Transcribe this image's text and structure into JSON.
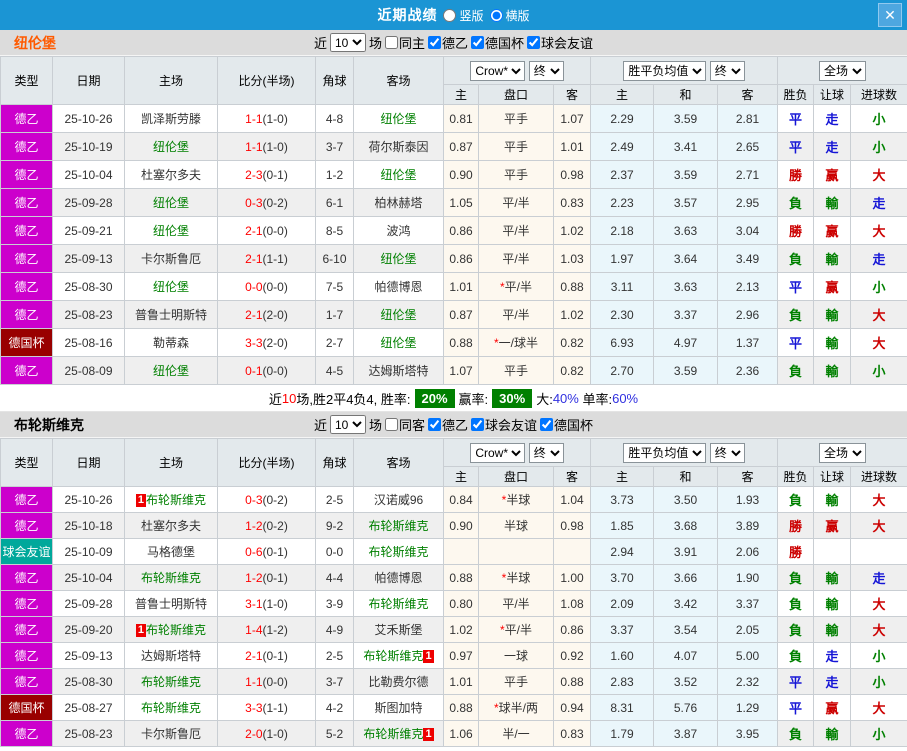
{
  "titlebar": {
    "title": "近期战绩",
    "radio_vertical_label": "竖版",
    "radio_vertical_checked": false,
    "radio_horizontal_label": "横版",
    "radio_horizontal_checked": true,
    "close_glyph": "✕"
  },
  "marks": {
    "star": "*",
    "red_card": "1"
  },
  "table_header": {
    "main_cols": [
      "类型",
      "日期",
      "主场",
      "比分(半场)",
      "角球",
      "客场"
    ],
    "sub_cols": [
      "主",
      "盘口",
      "客",
      "主",
      "和",
      "客",
      "胜负",
      "让球",
      "进球数"
    ],
    "company_select": "Crow*",
    "final_select_1": "终",
    "europe_select": "胜平负均值",
    "final_select_2": "终",
    "scope_select": "全场"
  },
  "sections": [
    {
      "team": "纽伦堡",
      "filter": {
        "near_label": "近",
        "count": "10",
        "games_label": "场",
        "same_label": "同主",
        "same_checked": false,
        "leagues": [
          {
            "label": "德乙",
            "checked": true
          },
          {
            "label": "德国杯",
            "checked": true
          },
          {
            "label": "球会友谊",
            "checked": true
          }
        ]
      },
      "rows": [
        {
          "type": "德乙",
          "type_class": "league",
          "date": "25-10-26",
          "home": "凯泽斯劳滕",
          "home_green": false,
          "home_badge": null,
          "score": "1-1",
          "half": "(1-0)",
          "corner": "4-8",
          "away": "纽伦堡",
          "away_green": true,
          "away_badge": null,
          "asia_home": "0.81",
          "handicap": "平手",
          "handicap_star": false,
          "asia_away": "1.07",
          "eu_home": "2.29",
          "eu_draw": "3.59",
          "eu_away": "2.81",
          "result": "平",
          "handicap_result": "走",
          "goals": "小"
        },
        {
          "type": "德乙",
          "type_class": "league",
          "date": "25-10-19",
          "home": "纽伦堡",
          "home_green": true,
          "home_badge": null,
          "score": "1-1",
          "half": "(1-0)",
          "corner": "3-7",
          "away": "荷尔斯泰因",
          "away_green": false,
          "away_badge": null,
          "asia_home": "0.87",
          "handicap": "平手",
          "handicap_star": false,
          "asia_away": "1.01",
          "eu_home": "2.49",
          "eu_draw": "3.41",
          "eu_away": "2.65",
          "result": "平",
          "handicap_result": "走",
          "goals": "小"
        },
        {
          "type": "德乙",
          "type_class": "league",
          "date": "25-10-04",
          "home": "杜塞尔多夫",
          "home_green": false,
          "home_badge": null,
          "score": "2-3",
          "half": "(0-1)",
          "corner": "1-2",
          "away": "纽伦堡",
          "away_green": true,
          "away_badge": null,
          "asia_home": "0.90",
          "handicap": "平手",
          "handicap_star": false,
          "asia_away": "0.98",
          "eu_home": "2.37",
          "eu_draw": "3.59",
          "eu_away": "2.71",
          "result": "勝",
          "handicap_result": "赢",
          "goals": "大"
        },
        {
          "type": "德乙",
          "type_class": "league",
          "date": "25-09-28",
          "home": "纽伦堡",
          "home_green": true,
          "home_badge": null,
          "score": "0-3",
          "half": "(0-2)",
          "corner": "6-1",
          "away": "柏林赫塔",
          "away_green": false,
          "away_badge": null,
          "asia_home": "1.05",
          "handicap": "平/半",
          "handicap_star": false,
          "asia_away": "0.83",
          "eu_home": "2.23",
          "eu_draw": "3.57",
          "eu_away": "2.95",
          "result": "負",
          "handicap_result": "輸",
          "goals": "走"
        },
        {
          "type": "德乙",
          "type_class": "league",
          "date": "25-09-21",
          "home": "纽伦堡",
          "home_green": true,
          "home_badge": null,
          "score": "2-1",
          "half": "(0-0)",
          "corner": "8-5",
          "away": "波鸿",
          "away_green": false,
          "away_badge": null,
          "asia_home": "0.86",
          "handicap": "平/半",
          "handicap_star": false,
          "asia_away": "1.02",
          "eu_home": "2.18",
          "eu_draw": "3.63",
          "eu_away": "3.04",
          "result": "勝",
          "handicap_result": "赢",
          "goals": "大"
        },
        {
          "type": "德乙",
          "type_class": "league",
          "date": "25-09-13",
          "home": "卡尔斯鲁厄",
          "home_green": false,
          "home_badge": null,
          "score": "2-1",
          "half": "(1-1)",
          "corner": "6-10",
          "away": "纽伦堡",
          "away_green": true,
          "away_badge": null,
          "asia_home": "0.86",
          "handicap": "平/半",
          "handicap_star": false,
          "asia_away": "1.03",
          "eu_home": "1.97",
          "eu_draw": "3.64",
          "eu_away": "3.49",
          "result": "負",
          "handicap_result": "輸",
          "goals": "走"
        },
        {
          "type": "德乙",
          "type_class": "league",
          "date": "25-08-30",
          "home": "纽伦堡",
          "home_green": true,
          "home_badge": null,
          "score": "0-0",
          "half": "(0-0)",
          "corner": "7-5",
          "away": "帕德博恩",
          "away_green": false,
          "away_badge": null,
          "asia_home": "1.01",
          "handicap": "平/半",
          "handicap_star": true,
          "asia_away": "0.88",
          "eu_home": "3.11",
          "eu_draw": "3.63",
          "eu_away": "2.13",
          "result": "平",
          "handicap_result": "赢",
          "goals": "小"
        },
        {
          "type": "德乙",
          "type_class": "league",
          "date": "25-08-23",
          "home": "普鲁士明斯特",
          "home_green": false,
          "home_badge": null,
          "score": "2-1",
          "half": "(2-0)",
          "corner": "1-7",
          "away": "纽伦堡",
          "away_green": true,
          "away_badge": null,
          "asia_home": "0.87",
          "handicap": "平/半",
          "handicap_star": false,
          "asia_away": "1.02",
          "eu_home": "2.30",
          "eu_draw": "3.37",
          "eu_away": "2.96",
          "result": "負",
          "handicap_result": "輸",
          "goals": "大"
        },
        {
          "type": "德国杯",
          "type_class": "cup",
          "date": "25-08-16",
          "home": "勒蒂森",
          "home_green": false,
          "home_badge": null,
          "score": "3-3",
          "half": "(2-0)",
          "corner": "2-7",
          "away": "纽伦堡",
          "away_green": true,
          "away_badge": null,
          "asia_home": "0.88",
          "handicap": "一/球半",
          "handicap_star": true,
          "asia_away": "0.82",
          "eu_home": "6.93",
          "eu_draw": "4.97",
          "eu_away": "1.37",
          "result": "平",
          "handicap_result": "輸",
          "goals": "大"
        },
        {
          "type": "德乙",
          "type_class": "league",
          "date": "25-08-09",
          "home": "纽伦堡",
          "home_green": true,
          "home_badge": null,
          "score": "0-1",
          "half": "(0-0)",
          "corner": "4-5",
          "away": "达姆斯塔特",
          "away_green": false,
          "away_badge": null,
          "asia_home": "1.07",
          "handicap": "平手",
          "handicap_star": false,
          "asia_away": "0.82",
          "eu_home": "2.70",
          "eu_draw": "3.59",
          "eu_away": "2.36",
          "result": "負",
          "handicap_result": "輸",
          "goals": "小"
        }
      ],
      "summary": {
        "text_near": "近",
        "text_count": "10",
        "text_record": "场,胜2平4负4, 胜率:",
        "win_rate": "20%",
        "text_profit": "赢率:",
        "profit_rate": "30%",
        "text_big": "大:",
        "big_rate": "40%",
        "text_single": "单率:",
        "single_rate": "60%"
      }
    },
    {
      "team": "布轮斯维克",
      "filter": {
        "near_label": "近",
        "count": "10",
        "games_label": "场",
        "same_label": "同客",
        "same_checked": false,
        "leagues": [
          {
            "label": "德乙",
            "checked": true
          },
          {
            "label": "球会友谊",
            "checked": true
          },
          {
            "label": "德国杯",
            "checked": true
          }
        ]
      },
      "rows": [
        {
          "type": "德乙",
          "type_class": "league",
          "date": "25-10-26",
          "home": "布轮斯维克",
          "home_green": true,
          "home_badge": "before",
          "score": "0-3",
          "half": "(0-2)",
          "corner": "2-5",
          "away": "汉诺威96",
          "away_green": false,
          "away_badge": null,
          "asia_home": "0.84",
          "handicap": "半球",
          "handicap_star": true,
          "asia_away": "1.04",
          "eu_home": "3.73",
          "eu_draw": "3.50",
          "eu_away": "1.93",
          "result": "負",
          "handicap_result": "輸",
          "goals": "大"
        },
        {
          "type": "德乙",
          "type_class": "league",
          "date": "25-10-18",
          "home": "杜塞尔多夫",
          "home_green": false,
          "home_badge": null,
          "score": "1-2",
          "half": "(0-2)",
          "corner": "9-2",
          "away": "布轮斯维克",
          "away_green": true,
          "away_badge": null,
          "asia_home": "0.90",
          "handicap": "半球",
          "handicap_star": false,
          "asia_away": "0.98",
          "eu_home": "1.85",
          "eu_draw": "3.68",
          "eu_away": "3.89",
          "result": "勝",
          "handicap_result": "赢",
          "goals": "大"
        },
        {
          "type": "球会友谊",
          "type_class": "friendly",
          "date": "25-10-09",
          "home": "马格德堡",
          "home_green": false,
          "home_badge": null,
          "score": "0-6",
          "half": "(0-1)",
          "corner": "0-0",
          "away": "布轮斯维克",
          "away_green": true,
          "away_badge": null,
          "asia_home": "",
          "handicap": "",
          "handicap_star": false,
          "asia_away": "",
          "eu_home": "2.94",
          "eu_draw": "3.91",
          "eu_away": "2.06",
          "result": "勝",
          "handicap_result": "",
          "goals": ""
        },
        {
          "type": "德乙",
          "type_class": "league",
          "date": "25-10-04",
          "home": "布轮斯维克",
          "home_green": true,
          "home_badge": null,
          "score": "1-2",
          "half": "(0-1)",
          "corner": "4-4",
          "away": "帕德博恩",
          "away_green": false,
          "away_badge": null,
          "asia_home": "0.88",
          "handicap": "半球",
          "handicap_star": true,
          "asia_away": "1.00",
          "eu_home": "3.70",
          "eu_draw": "3.66",
          "eu_away": "1.90",
          "result": "負",
          "handicap_result": "輸",
          "goals": "走"
        },
        {
          "type": "德乙",
          "type_class": "league",
          "date": "25-09-28",
          "home": "普鲁士明斯特",
          "home_green": false,
          "home_badge": null,
          "score": "3-1",
          "half": "(1-0)",
          "corner": "3-9",
          "away": "布轮斯维克",
          "away_green": true,
          "away_badge": null,
          "asia_home": "0.80",
          "handicap": "平/半",
          "handicap_star": false,
          "asia_away": "1.08",
          "eu_home": "2.09",
          "eu_draw": "3.42",
          "eu_away": "3.37",
          "result": "負",
          "handicap_result": "輸",
          "goals": "大"
        },
        {
          "type": "德乙",
          "type_class": "league",
          "date": "25-09-20",
          "home": "布轮斯维克",
          "home_green": true,
          "home_badge": "before",
          "score": "1-4",
          "half": "(1-2)",
          "corner": "4-9",
          "away": "艾禾斯堡",
          "away_green": false,
          "away_badge": null,
          "asia_home": "1.02",
          "handicap": "平/半",
          "handicap_star": true,
          "asia_away": "0.86",
          "eu_home": "3.37",
          "eu_draw": "3.54",
          "eu_away": "2.05",
          "result": "負",
          "handicap_result": "輸",
          "goals": "大"
        },
        {
          "type": "德乙",
          "type_class": "league",
          "date": "25-09-13",
          "home": "达姆斯塔特",
          "home_green": false,
          "home_badge": null,
          "score": "2-1",
          "half": "(0-1)",
          "corner": "2-5",
          "away": "布轮斯维克",
          "away_green": true,
          "away_badge": "after",
          "asia_home": "0.97",
          "handicap": "一球",
          "handicap_star": false,
          "asia_away": "0.92",
          "eu_home": "1.60",
          "eu_draw": "4.07",
          "eu_away": "5.00",
          "result": "負",
          "handicap_result": "走",
          "goals": "小"
        },
        {
          "type": "德乙",
          "type_class": "league",
          "date": "25-08-30",
          "home": "布轮斯维克",
          "home_green": true,
          "home_badge": null,
          "score": "1-1",
          "half": "(0-0)",
          "corner": "3-7",
          "away": "比勒费尔德",
          "away_green": false,
          "away_badge": null,
          "asia_home": "1.01",
          "handicap": "平手",
          "handicap_star": false,
          "asia_away": "0.88",
          "eu_home": "2.83",
          "eu_draw": "3.52",
          "eu_away": "2.32",
          "result": "平",
          "handicap_result": "走",
          "goals": "小"
        },
        {
          "type": "德国杯",
          "type_class": "cup",
          "date": "25-08-27",
          "home": "布轮斯维克",
          "home_green": true,
          "home_badge": null,
          "score": "3-3",
          "half": "(1-1)",
          "corner": "4-2",
          "away": "斯图加特",
          "away_green": false,
          "away_badge": null,
          "asia_home": "0.88",
          "handicap": "球半/两",
          "handicap_star": true,
          "asia_away": "0.94",
          "eu_home": "8.31",
          "eu_draw": "5.76",
          "eu_away": "1.29",
          "result": "平",
          "handicap_result": "赢",
          "goals": "大"
        },
        {
          "type": "德乙",
          "type_class": "league",
          "date": "25-08-23",
          "home": "卡尔斯鲁厄",
          "home_green": false,
          "home_badge": null,
          "score": "2-0",
          "half": "(1-0)",
          "corner": "5-2",
          "away": "布轮斯维克",
          "away_green": true,
          "away_badge": "after",
          "asia_home": "1.06",
          "handicap": "半/一",
          "handicap_star": false,
          "asia_away": "0.83",
          "eu_home": "1.79",
          "eu_draw": "3.87",
          "eu_away": "3.95",
          "result": "負",
          "handicap_result": "輸",
          "goals": "小"
        }
      ]
    }
  ]
}
